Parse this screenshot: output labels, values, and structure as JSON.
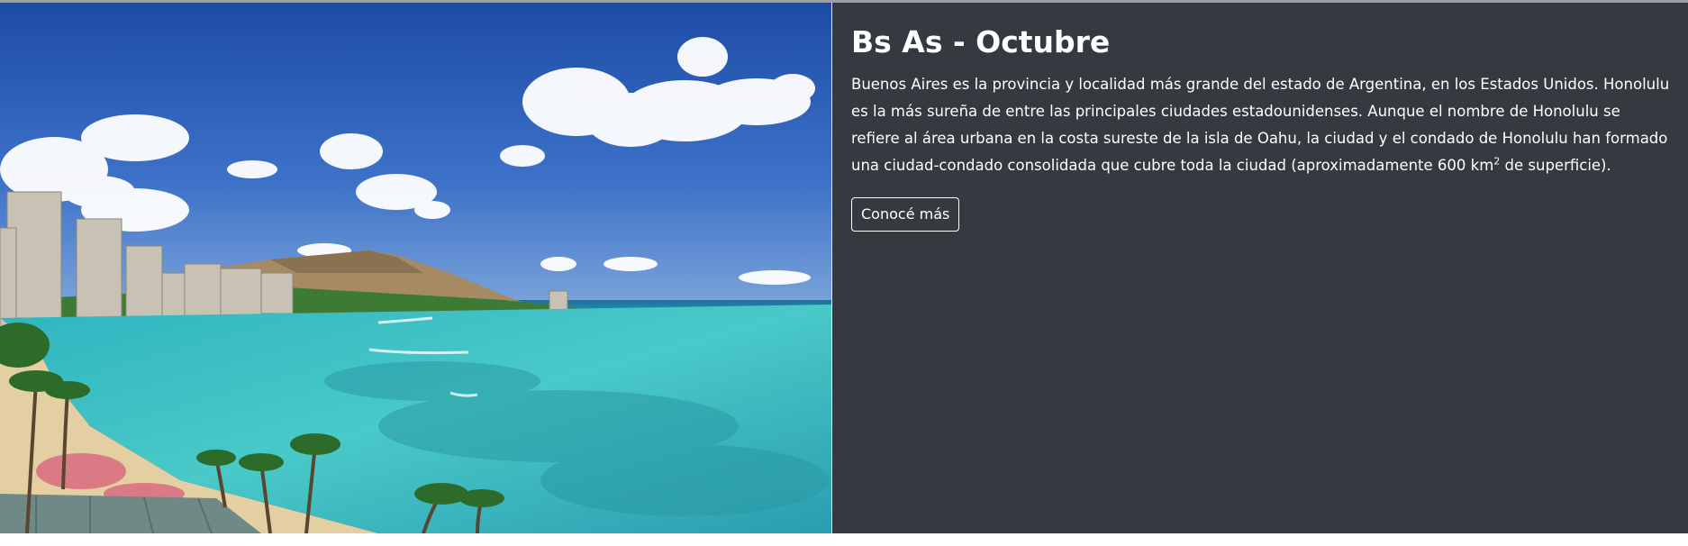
{
  "card": {
    "image": {
      "alt": "Honolulu Waikiki beach",
      "colors": {
        "sky_top": "#1f4fa8",
        "sky_bottom": "#5c8ad4",
        "sea_deep": "#1a8fa0",
        "sea_light": "#4fd0cf",
        "sand": "#e8d3a7",
        "cloud": "#ffffff",
        "mountain": "#a88f6a",
        "vegetation": "#3f7a35",
        "building": "#c9c4b8"
      }
    },
    "title": "Bs As - Octubre",
    "text_main": "Buenos Aires es la provincia y localidad más grande del estado de Argentina, en los Estados Unidos. Honolulu es la más sureña de entre las principales ciudades estadounidenses. Aunque el nombre de Honolulu se refiere al área urbana en la costa sureste de la isla de Oahu, la ciudad y el condado de Honolulu han formado una ciudad-condado consolidada que cubre toda la ciudad (aproximadamente 600 km",
    "text_sup": "2",
    "text_end": " de superficie).",
    "button_label": "Conocé más",
    "colors": {
      "card_bg": "#343a40",
      "text": "#ffffff"
    }
  }
}
